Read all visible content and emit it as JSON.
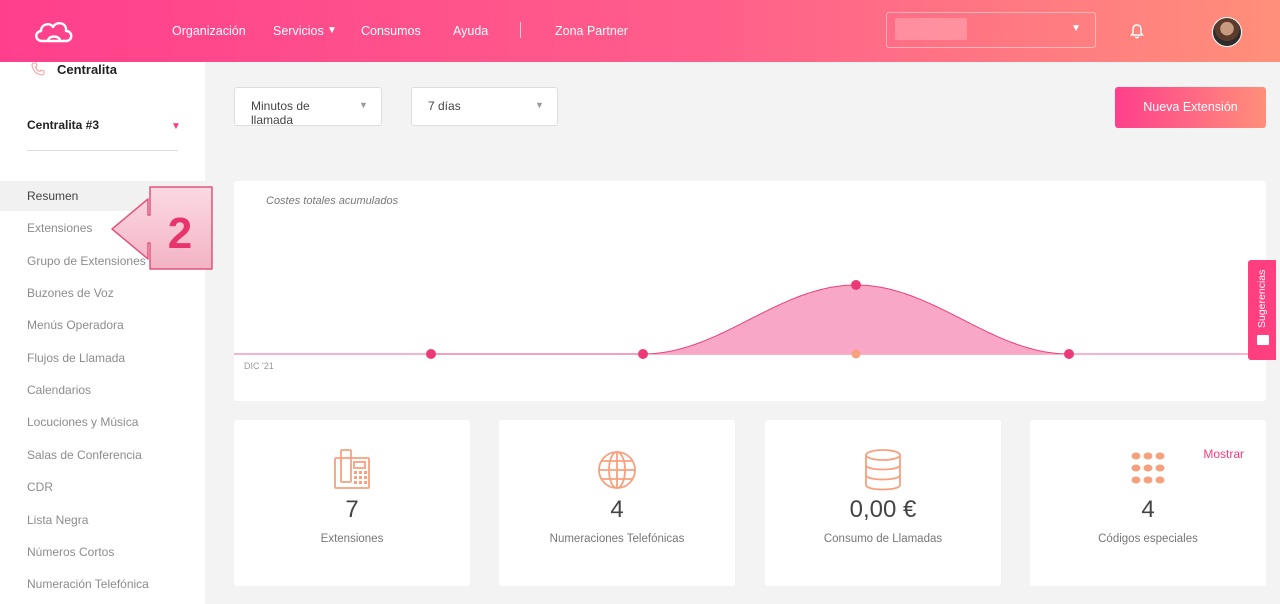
{
  "header": {
    "nav": [
      "Organización",
      "Servicios",
      "Consumos",
      "Ayuda",
      "Zona Partner"
    ]
  },
  "sidebar": {
    "title": "Centralita",
    "selected": "Centralita #3",
    "items": [
      "Resumen",
      "Extensiones",
      "Grupo de Extensiones",
      "Buzones de Voz",
      "Menús Operadora",
      "Flujos de Llamada",
      "Calendarios",
      "Locuciones y Música",
      "Salas de Conferencia",
      "CDR",
      "Lista Negra",
      "Números Cortos",
      "Numeración Telefónica"
    ],
    "active_index": 0
  },
  "annotation": {
    "number": "2"
  },
  "filters": {
    "metric": "Minutos de llamada",
    "period": "7 días"
  },
  "new_button": "Nueva Extensión",
  "chart": {
    "title": "Costes totales acumulados",
    "xlabel": "DIC '21"
  },
  "chart_data": {
    "type": "area",
    "title": "Costes totales acumulados",
    "xlabel": "DIC '21",
    "ylabel": "",
    "values": [
      0,
      0,
      1,
      0
    ],
    "grid": false
  },
  "suggestions_tab": "Sugerencias",
  "stats": [
    {
      "icon": "phone-fax-icon",
      "value": "7",
      "label": "Extensiones"
    },
    {
      "icon": "globe-icon",
      "value": "4",
      "label": "Numeraciones Telefónicas"
    },
    {
      "icon": "database-icon",
      "value": "0,00 €",
      "label": "Consumo de Llamadas"
    },
    {
      "icon": "keypad-icon",
      "value": "4",
      "label": "Códigos especiales",
      "action": "Mostrar"
    }
  ],
  "colors": {
    "accent": "#ff3f8c",
    "accent_end": "#ff8f7a",
    "chart_fill": "#f9a7c7",
    "icon": "#f7a07e"
  }
}
